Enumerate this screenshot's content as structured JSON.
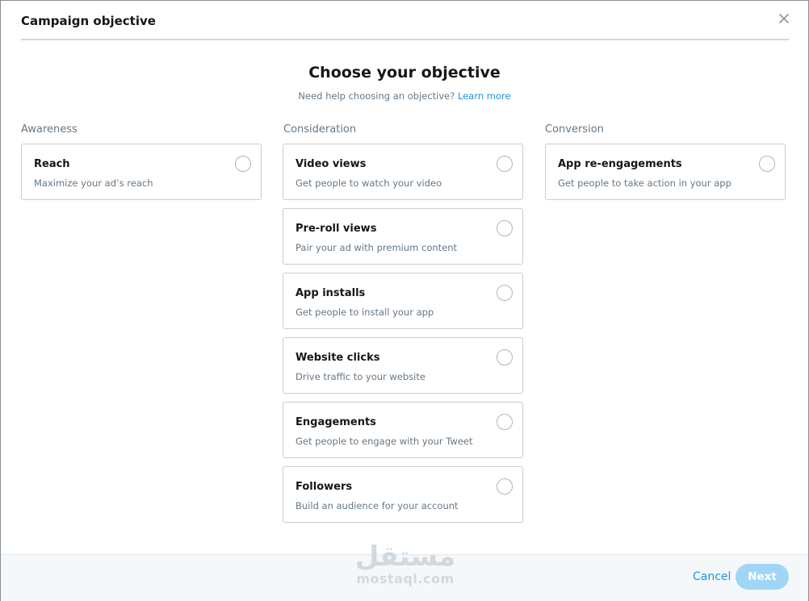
{
  "modal": {
    "title": "Campaign objective",
    "close_icon": "close-icon"
  },
  "main": {
    "title": "Choose your objective",
    "help_text": "Need help choosing an objective?",
    "help_link": "Learn more"
  },
  "columns": [
    {
      "title": "Awareness",
      "options": [
        {
          "title": "Reach",
          "desc": "Maximize your ad’s reach"
        }
      ]
    },
    {
      "title": "Consideration",
      "options": [
        {
          "title": "Video views",
          "desc": "Get people to watch your video"
        },
        {
          "title": "Pre-roll views",
          "desc": "Pair your ad with premium content"
        },
        {
          "title": "App installs",
          "desc": "Get people to install your app"
        },
        {
          "title": "Website clicks",
          "desc": "Drive traffic to your website"
        },
        {
          "title": "Engagements",
          "desc": "Get people to engage with your Tweet"
        },
        {
          "title": "Followers",
          "desc": "Build an audience for your account"
        }
      ]
    },
    {
      "title": "Conversion",
      "options": [
        {
          "title": "App re-engagements",
          "desc": "Get people to take action in your app"
        }
      ]
    }
  ],
  "footer": {
    "cancel": "Cancel",
    "next": "Next"
  },
  "watermark": {
    "arabic": "مستقل",
    "latin": "mostaql.com"
  },
  "colors": {
    "accent": "#1b95e0",
    "next_disabled": "#a1d5f6",
    "border": "#c5cdd3",
    "muted_text": "#657786"
  }
}
